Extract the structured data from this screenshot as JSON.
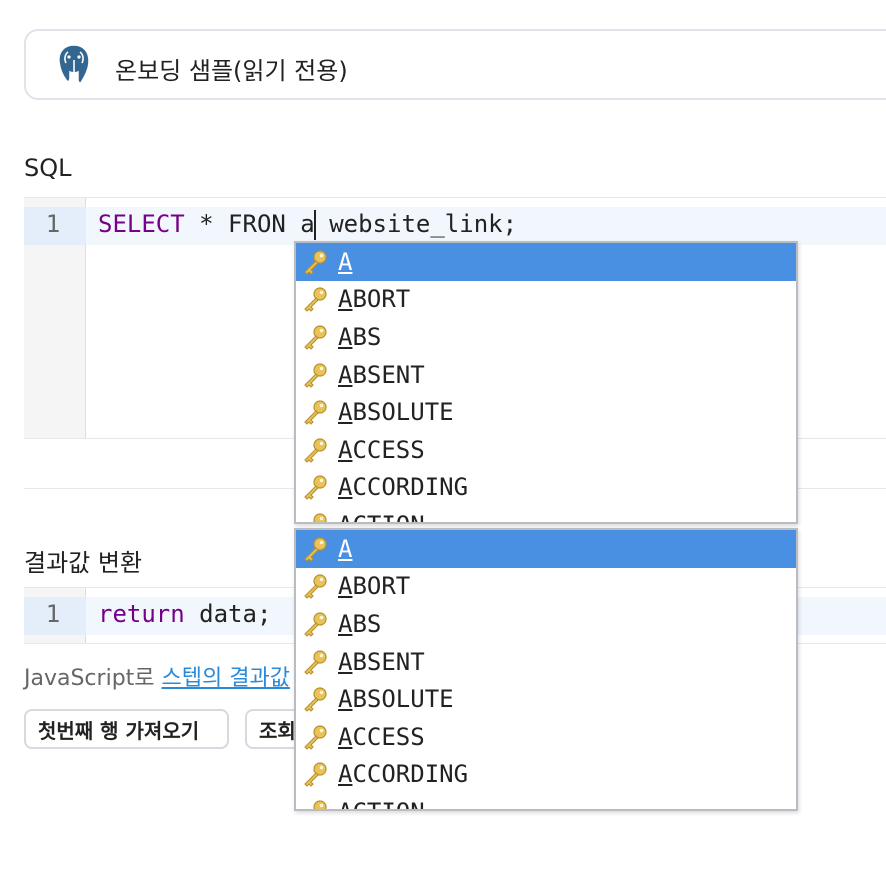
{
  "datasource": {
    "name": "온보딩 샘플(읽기 전용)",
    "icon": "postgresql-elephant-icon"
  },
  "sql_section": {
    "title": "SQL",
    "line_number": "1",
    "code": {
      "keyword": "SELECT",
      "text_before_cursor": " * FRON a",
      "text_after_cursor": " website_link;"
    }
  },
  "transform_section": {
    "title": "결과값 변환",
    "line_number": "1",
    "code": {
      "keyword": "return",
      "rest": " data;"
    }
  },
  "hint": {
    "prefix": "JavaScript로 ",
    "link": "스텝의 결과값"
  },
  "buttons": {
    "fetch_first_row": "첫번째 행 가져오기",
    "query": "조회"
  },
  "autocomplete": {
    "selected_index": 0,
    "item_icon": "key-icon",
    "items": [
      {
        "first": "A",
        "rest": ""
      },
      {
        "first": "A",
        "rest": "BORT"
      },
      {
        "first": "A",
        "rest": "BS"
      },
      {
        "first": "A",
        "rest": "BSENT"
      },
      {
        "first": "A",
        "rest": "BSOLUTE"
      },
      {
        "first": "A",
        "rest": "CCESS"
      },
      {
        "first": "A",
        "rest": "CCORDING"
      },
      {
        "first": "A",
        "rest": "CTION"
      }
    ]
  },
  "colors": {
    "keyword": "#770088",
    "selection": "#4a90e2",
    "link": "#2b8ad8"
  }
}
